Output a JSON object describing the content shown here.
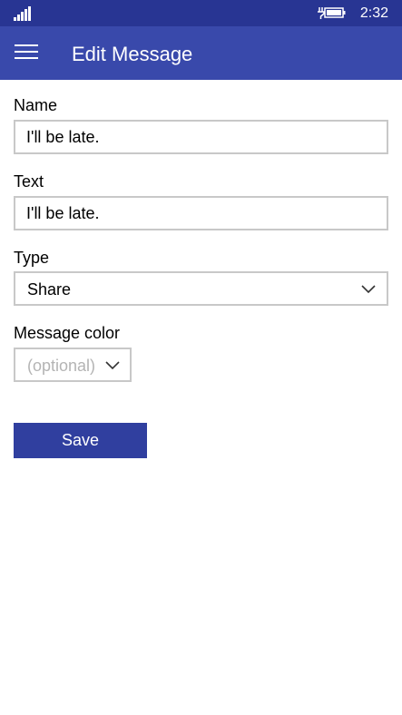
{
  "status_bar": {
    "time": "2:32",
    "signal_icon": "signal-strength-icon",
    "battery_icon": "battery-charging-icon"
  },
  "app_bar": {
    "title": "Edit Message",
    "menu_icon": "hamburger-menu-icon"
  },
  "form": {
    "name": {
      "label": "Name",
      "value": "I'll be late."
    },
    "text": {
      "label": "Text",
      "value": "I'll be late."
    },
    "type": {
      "label": "Type",
      "selected": "Share"
    },
    "message_color": {
      "label": "Message color",
      "placeholder": "(optional)"
    },
    "save_label": "Save"
  },
  "colors": {
    "status_bar": "#283593",
    "app_bar": "#3949ab",
    "accent": "#303f9f",
    "input_border": "#c8c8c8",
    "placeholder_text": "#b4b4b4"
  }
}
